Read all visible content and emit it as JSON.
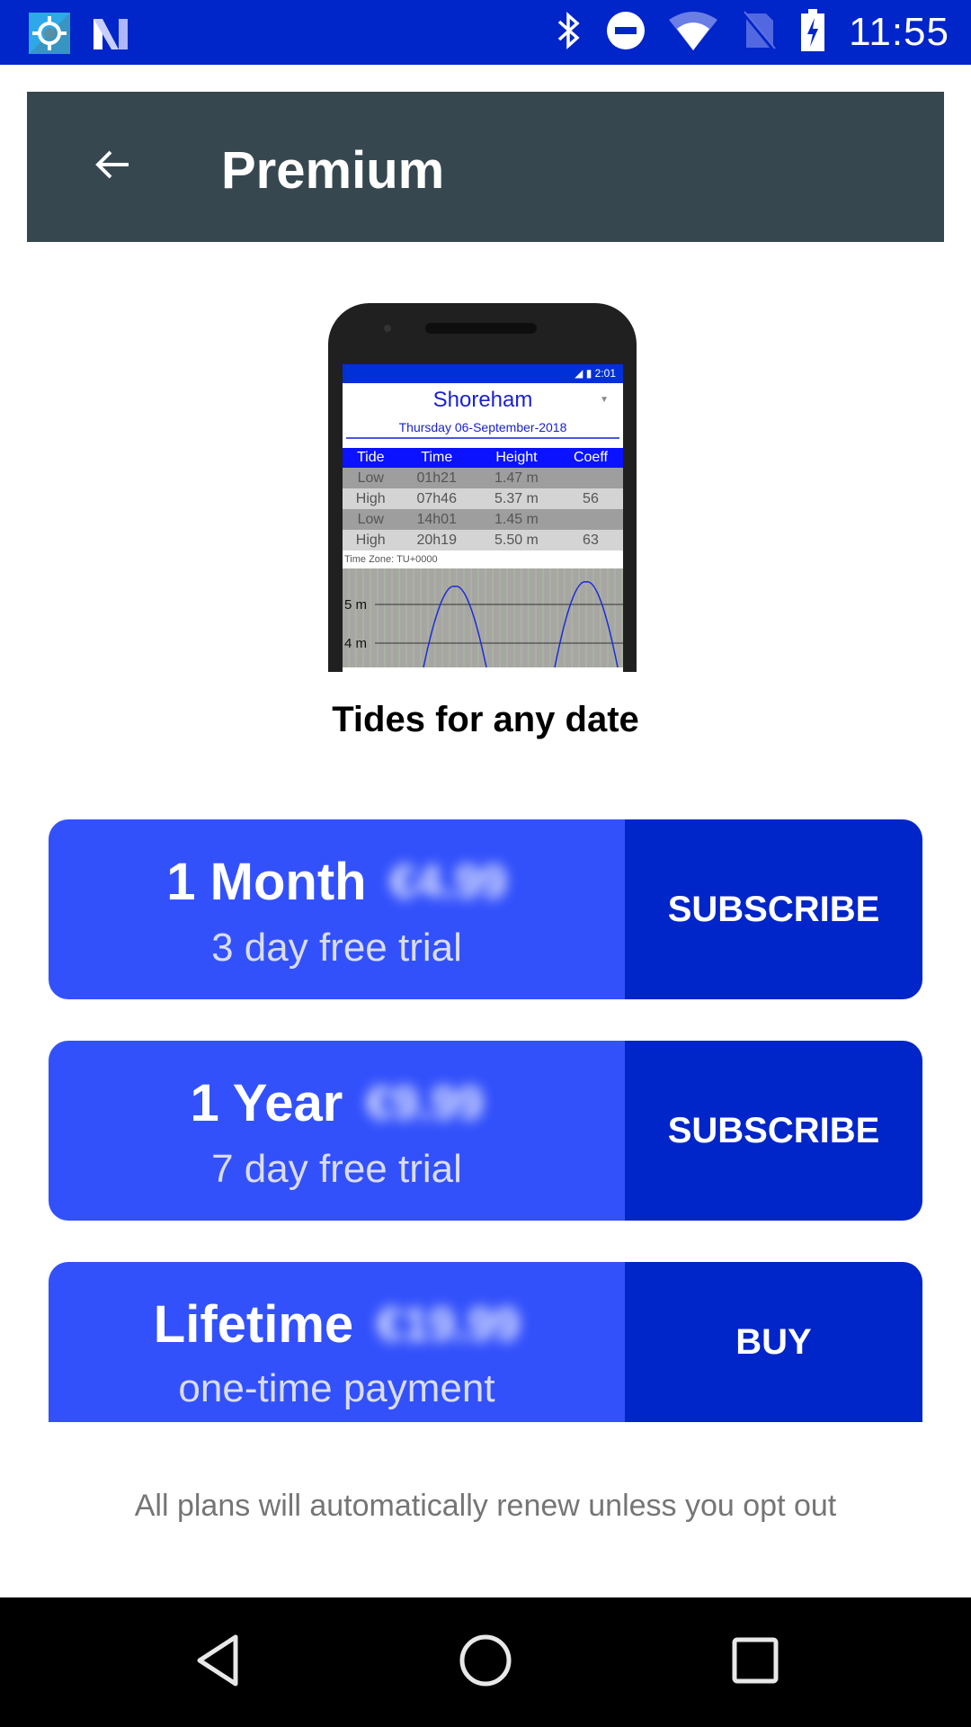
{
  "status_bar": {
    "time": "11:55",
    "left_icons": [
      "location-app-icon",
      "n-app-icon"
    ],
    "right_icons": [
      "bluetooth-icon",
      "do-not-disturb-icon",
      "wifi-icon",
      "no-sim-icon",
      "battery-charging-icon"
    ],
    "color": "#0025c9"
  },
  "app_bar": {
    "title": "Premium",
    "back_icon": "arrow-left-icon",
    "color": "#37474f"
  },
  "preview": {
    "status_time": "2:01",
    "location": "Shoreham",
    "date": "Thursday 06-September-2018",
    "table": {
      "headers": [
        "Tide",
        "Time",
        "Height",
        "Coeff"
      ],
      "rows": [
        [
          "Low",
          "01h21",
          "1.47 m",
          ""
        ],
        [
          "High",
          "07h46",
          "5.37 m",
          "56"
        ],
        [
          "Low",
          "14h01",
          "1.45 m",
          ""
        ],
        [
          "High",
          "20h19",
          "5.50 m",
          "63"
        ]
      ]
    },
    "time_zone": "Time Zone: TU+0000",
    "graph_labels": [
      "5 m",
      "4 m"
    ]
  },
  "feature_caption": "Tides for any date",
  "plans": [
    {
      "name": "1 Month",
      "price": "€4.99",
      "subtitle": "3 day free trial",
      "action": "SUBSCRIBE"
    },
    {
      "name": "1 Year",
      "price": "€9.99",
      "subtitle": "7 day free trial",
      "action": "SUBSCRIBE"
    },
    {
      "name": "Lifetime",
      "price": "€19.99",
      "subtitle": "one-time payment",
      "action": "BUY"
    }
  ],
  "colors": {
    "plan_info": "#3351fb",
    "plan_action": "#0025c9"
  },
  "footnote": "All plans will automatically renew unless you opt out",
  "nav_bar": {
    "buttons": [
      "back-triangle-icon",
      "home-circle-icon",
      "recents-square-icon"
    ]
  }
}
